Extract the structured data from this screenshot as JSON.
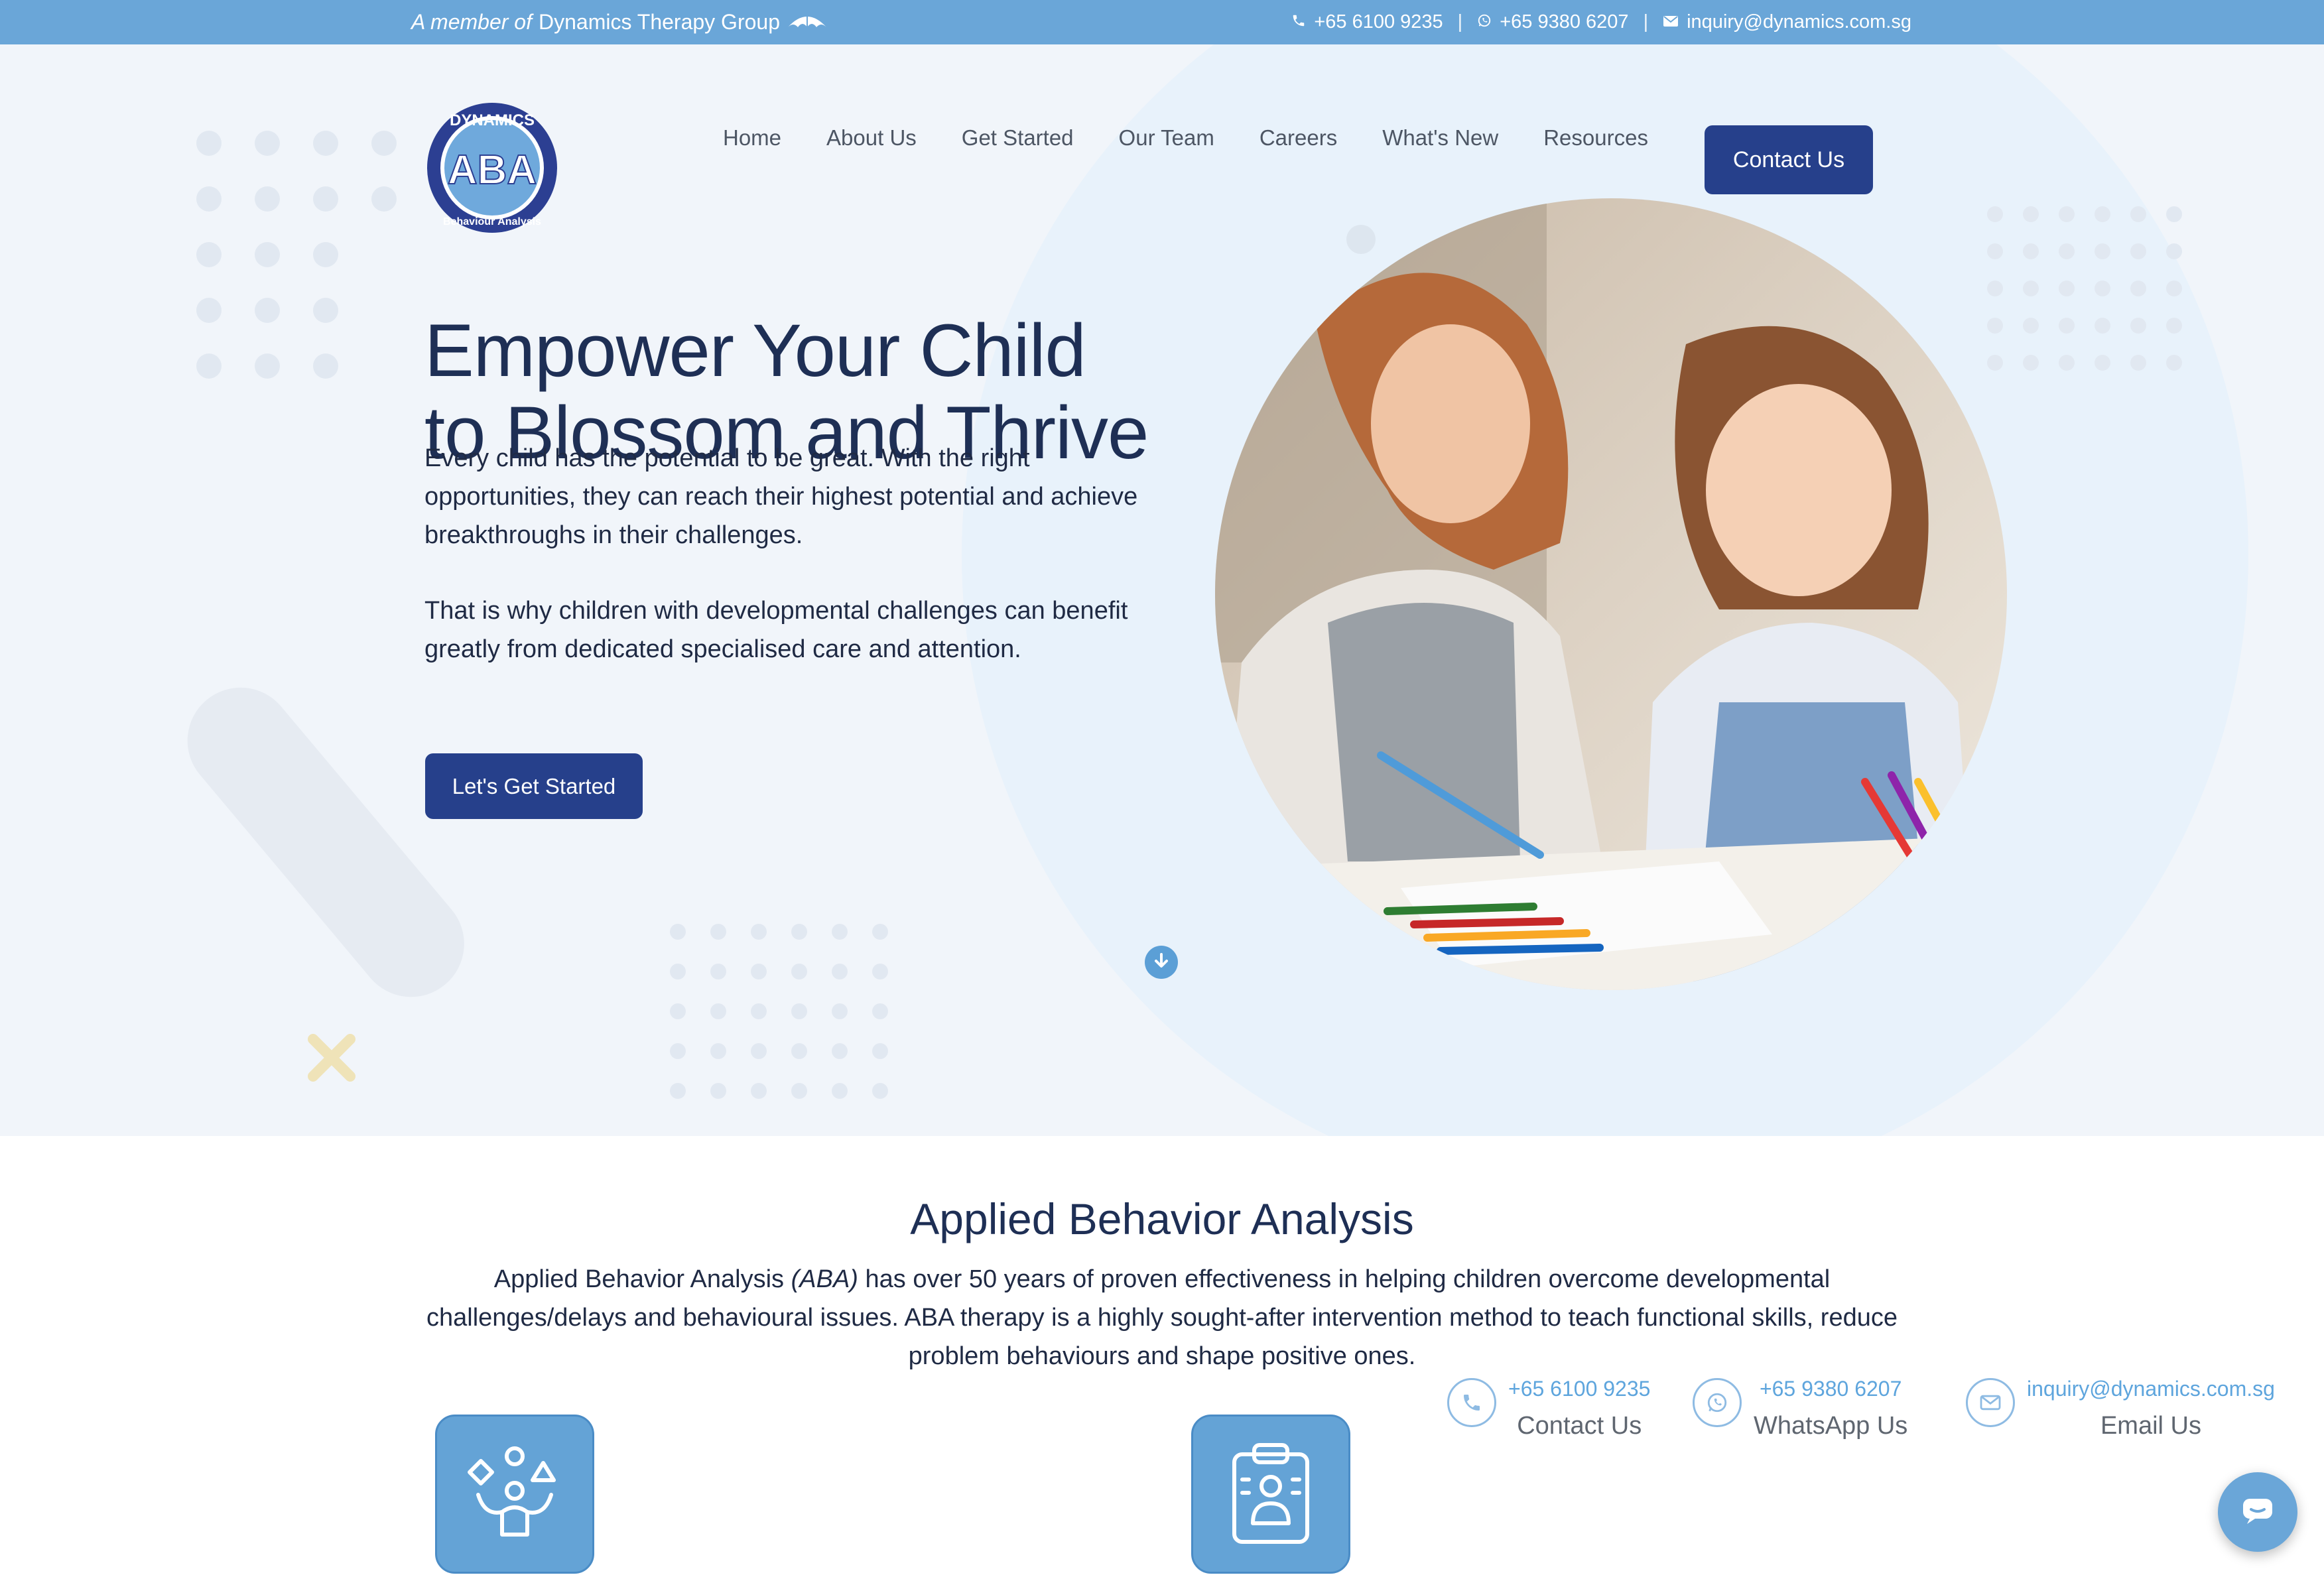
{
  "topbar": {
    "member_prefix": "A member of",
    "member_group": "Dynamics Therapy Group",
    "phone": "+65 6100 9235",
    "whatsapp": "+65 9380 6207",
    "email": "inquiry@dynamics.com.sg",
    "separator": "|"
  },
  "logo": {
    "top_text": "DYNAMICS",
    "center_text": "ABA",
    "bottom_text": "Behaviour Analysis"
  },
  "nav": {
    "items": [
      "Home",
      "About Us",
      "Get Started",
      "Our Team",
      "Careers",
      "What's New",
      "Resources"
    ],
    "contact_button": "Contact Us"
  },
  "hero": {
    "title_line1": "Empower Your Child",
    "title_line2": "to Blossom and Thrive",
    "paragraph1": "Every child has the potential to be great. With the right opportunities, they can reach their highest potential and achieve breakthroughs in their challenges.",
    "paragraph2": "That is why children with developmental challenges can benefit greatly from dedicated specialised care and attention.",
    "cta": "Let's Get Started"
  },
  "aba": {
    "title": "Applied Behavior Analysis",
    "text_start": "Applied Behavior Analysis ",
    "text_italic": "(ABA)",
    "text_end": " has over 50 years of proven effectiveness in helping children overcome developmental challenges/delays and behavioural issues. ABA therapy is a highly sought-after intervention method to teach functional skills, reduce problem behaviours and shape positive ones."
  },
  "floating_contacts": [
    {
      "value": "+65 6100 9235",
      "label": "Contact Us",
      "icon": "phone-icon"
    },
    {
      "value": "+65 9380 6207",
      "label": "WhatsApp Us",
      "icon": "whatsapp-icon"
    },
    {
      "value": "inquiry@dynamics.com.sg",
      "label": "Email Us",
      "icon": "mail-icon"
    }
  ],
  "colors": {
    "topbar": "#6aa6d8",
    "primary_navy": "#26408b",
    "heading": "#1e2f55",
    "accent_blue": "#5ea5dd",
    "hero_bg": "#f1f5fa"
  }
}
